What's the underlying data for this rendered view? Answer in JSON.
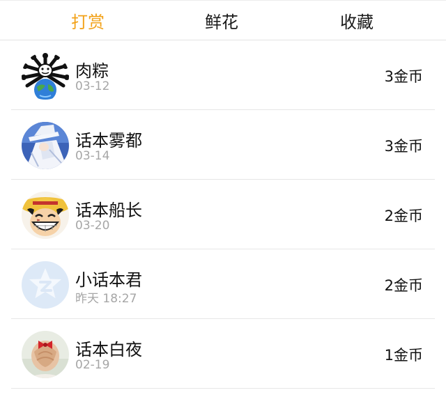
{
  "tabs": [
    {
      "label": "打赏",
      "active": true
    },
    {
      "label": "鲜花",
      "active": false
    },
    {
      "label": "收藏",
      "active": false
    }
  ],
  "accent_color": "#f2a21a",
  "rewards": [
    {
      "name": "肉粽",
      "time": "03-12",
      "amount": "3金币",
      "avatar_icon": "earth-meme-avatar-icon"
    },
    {
      "name": "话本雾都",
      "time": "03-14",
      "amount": "3金币",
      "avatar_icon": "kid-avatar-icon"
    },
    {
      "name": "话本船长",
      "time": "03-20",
      "amount": "2金币",
      "avatar_icon": "luffy-avatar-icon"
    },
    {
      "name": "小话本君",
      "time": "昨天 18:27",
      "amount": "2金币",
      "avatar_icon": "default-avatar-icon"
    },
    {
      "name": "话本白夜",
      "time": "02-19",
      "amount": "1金币",
      "avatar_icon": "girl-bow-avatar-icon"
    }
  ]
}
